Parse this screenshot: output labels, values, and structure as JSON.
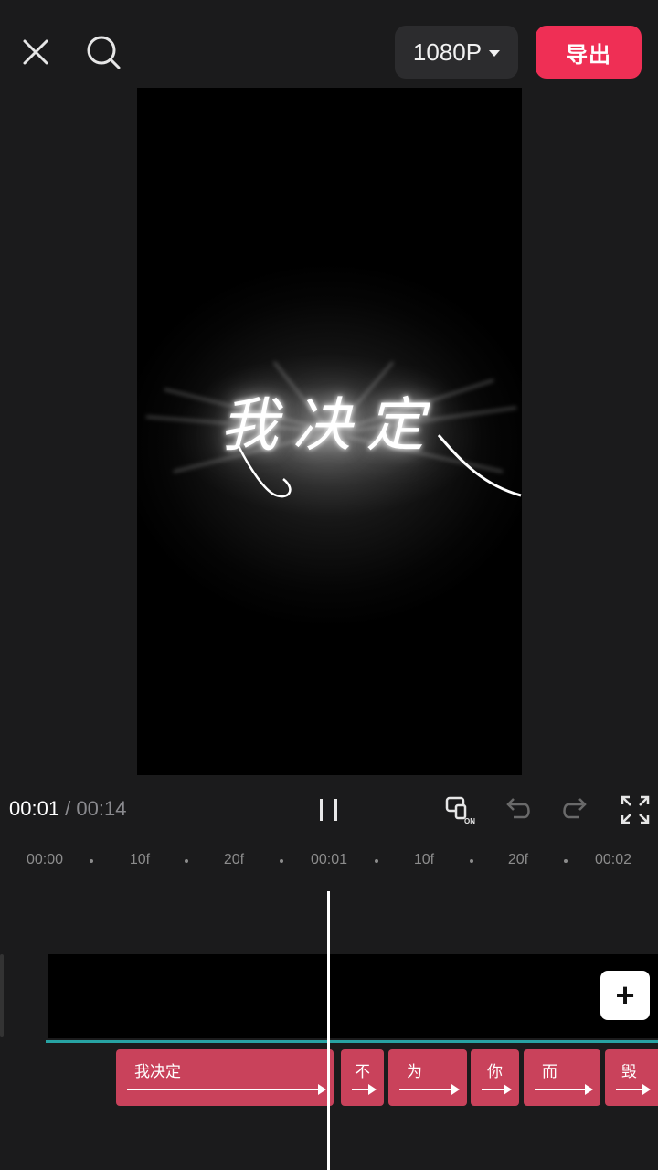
{
  "topbar": {
    "resolution": "1080P",
    "export_label": "导出"
  },
  "preview": {
    "text": "我决定"
  },
  "playback": {
    "current_time": "00:01",
    "separator": " / ",
    "total_time": "00:14"
  },
  "ruler": {
    "labels": [
      "00:00",
      "10f",
      "20f",
      "00:01",
      "10f",
      "20f",
      "00:02"
    ]
  },
  "timeline": {
    "add_label": "+",
    "text_clips": [
      {
        "label": "我决定"
      },
      {
        "label": "不"
      },
      {
        "label": "为"
      },
      {
        "label": "你"
      },
      {
        "label": "而"
      },
      {
        "label": "毁"
      }
    ]
  },
  "colors": {
    "background": "#1b1b1c",
    "export": "#ef2f55",
    "text_clip": "#c9425b",
    "track_line": "#27a3a3"
  },
  "icons": [
    "close-icon",
    "search-icon",
    "chevron-down-icon",
    "pause-icon",
    "keyframe-on-icon",
    "undo-icon",
    "redo-icon",
    "fullscreen-icon"
  ]
}
